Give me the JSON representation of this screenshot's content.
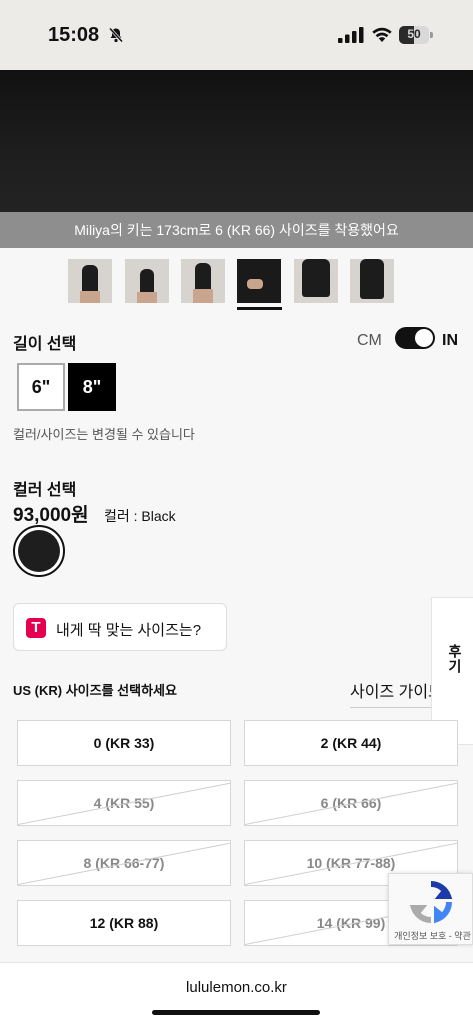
{
  "status_bar": {
    "time": "15:08",
    "battery": "50",
    "battery_level": 0.5
  },
  "hero": {
    "caption": "Miliya의 키는 173cm로 6 (KR 66) 사이즈를 착용했어요"
  },
  "length": {
    "title": "길이 선택",
    "unit_cm": "CM",
    "unit_in": "IN",
    "options": [
      "6\"",
      "8\""
    ],
    "selected": "8\"",
    "note": "컬러/사이즈는 변경될 수 있습니다"
  },
  "color": {
    "title": "컬러 선택",
    "price": "93,000원",
    "color_label": "컬러 : Black",
    "swatch_color": "#1e1e1e"
  },
  "fit": {
    "logo": "T",
    "label": "내게 딱 맞는 사이즈는?"
  },
  "side_tab": {
    "label": "후기"
  },
  "sizes": {
    "title": "US (KR) 사이즈를 선택하세요",
    "guide": "사이즈 가이드",
    "options": [
      {
        "label": "0 (KR 33)",
        "available": true
      },
      {
        "label": "2 (KR 44)",
        "available": true
      },
      {
        "label": "4 (KR 55)",
        "available": false
      },
      {
        "label": "6 (KR 66)",
        "available": false
      },
      {
        "label": "8 (KR 66-77)",
        "available": false
      },
      {
        "label": "10 (KR 77-88)",
        "available": false
      },
      {
        "label": "12 (KR 88)",
        "available": true
      },
      {
        "label": "14 (KR 99)",
        "available": false
      }
    ]
  },
  "recaptcha": {
    "text": "개인정보 보호 - 약관"
  },
  "browser": {
    "url": "lululemon.co.kr"
  }
}
